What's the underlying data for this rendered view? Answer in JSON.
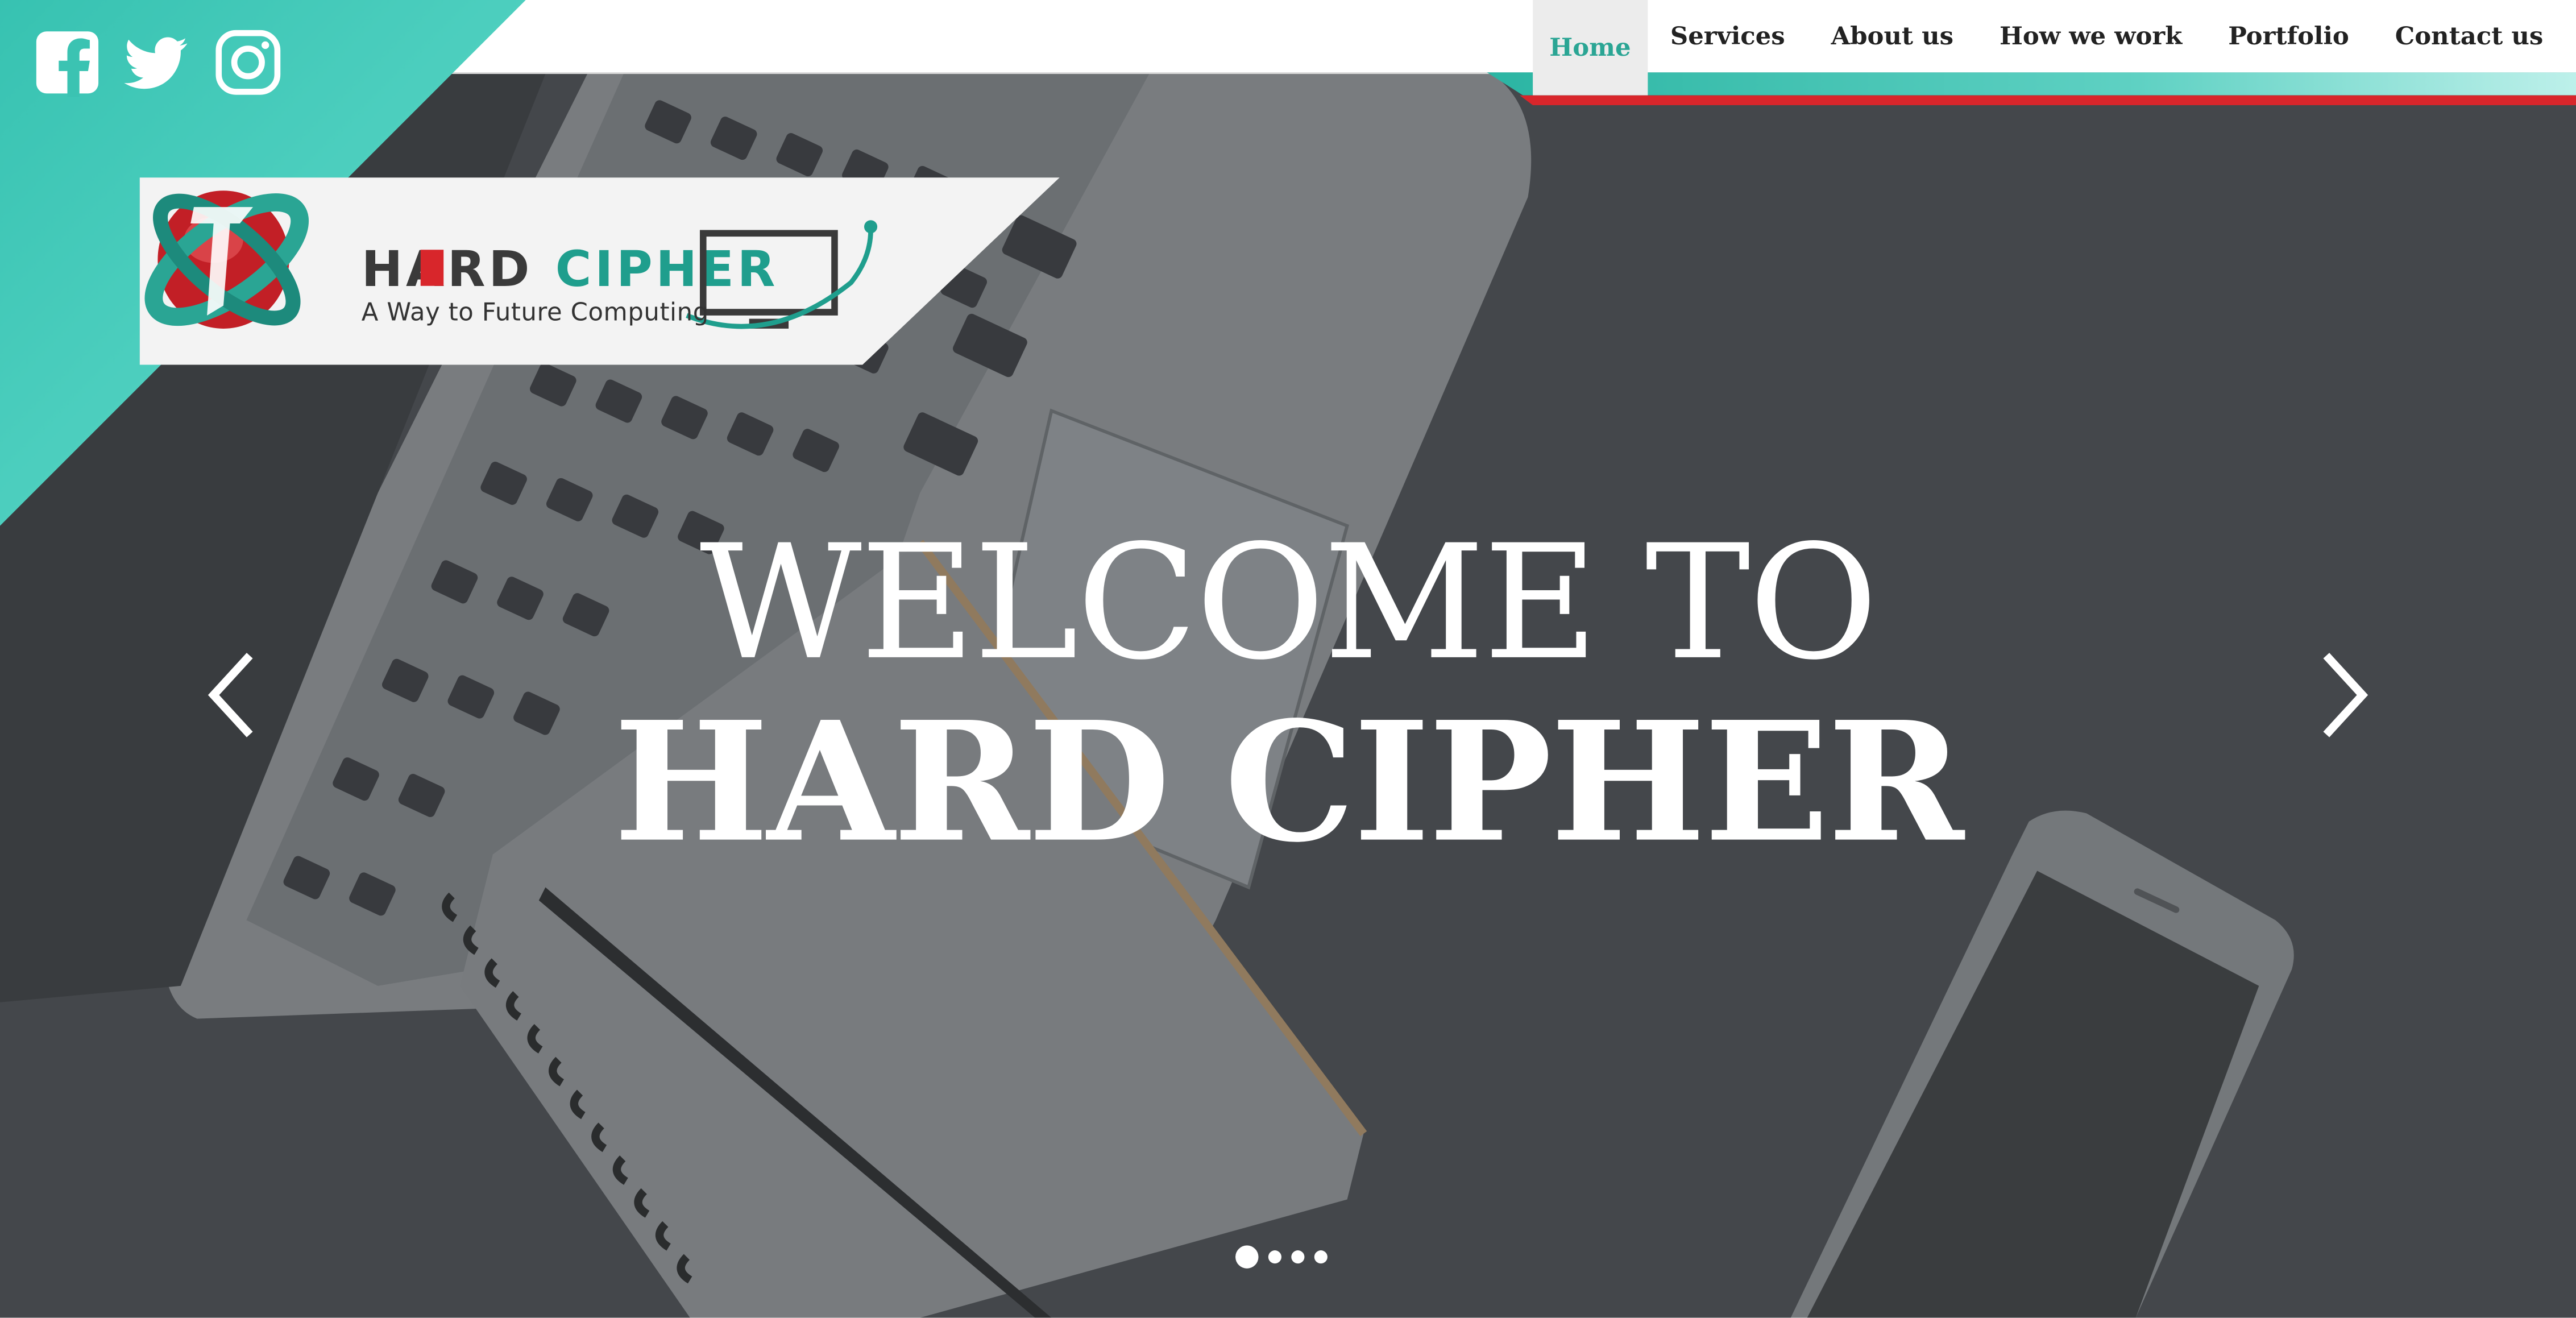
{
  "brand": {
    "name": "HARD CIPHER",
    "tagline": "A Way to Future Computing"
  },
  "nav": {
    "items": [
      {
        "label": "Home",
        "active": true
      },
      {
        "label": "Services",
        "active": false
      },
      {
        "label": "About us",
        "active": false
      },
      {
        "label": "How we work",
        "active": false
      },
      {
        "label": "Portfolio",
        "active": false
      },
      {
        "label": "Contact us",
        "active": false
      }
    ]
  },
  "social": [
    "facebook-icon",
    "twitter-icon",
    "instagram-icon"
  ],
  "hero": {
    "line1": "WELCOME TO",
    "line2": "HARD CIPHER"
  },
  "carousel": {
    "slide_count": 4,
    "active_index": 0
  },
  "colors": {
    "accent": "#2aa594",
    "teal": "#37c2b1",
    "red": "#d8262b"
  }
}
